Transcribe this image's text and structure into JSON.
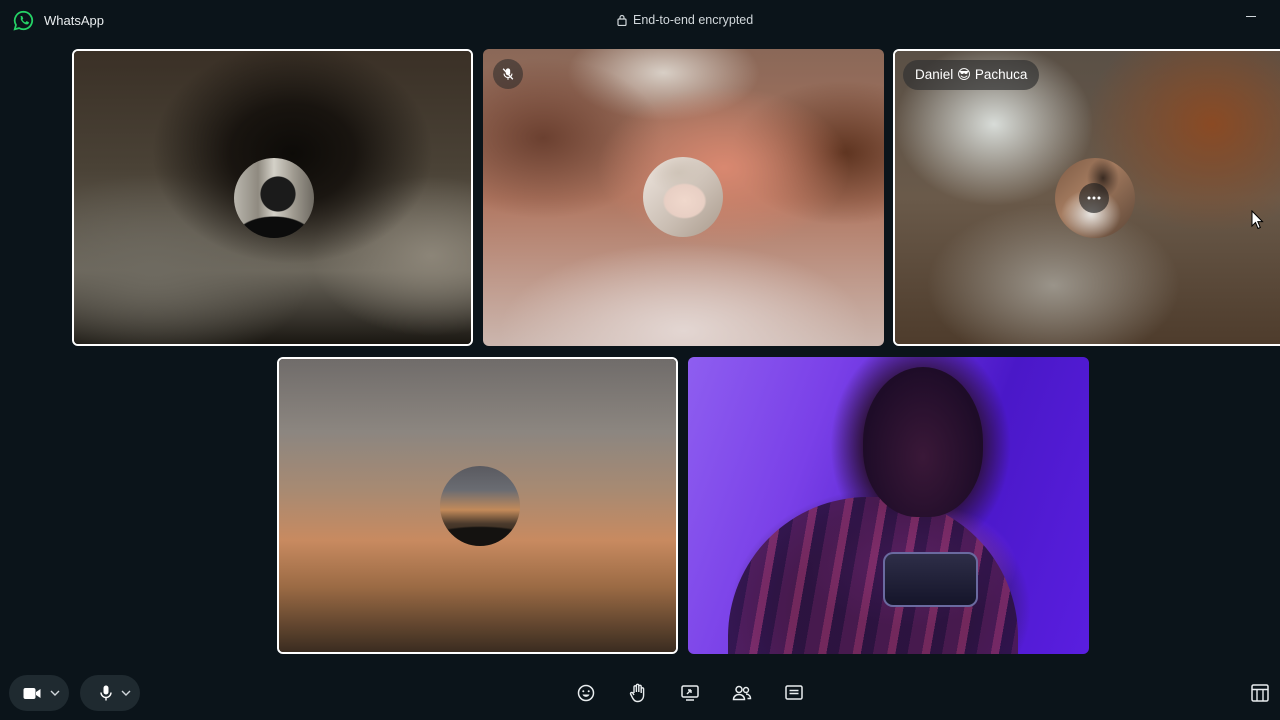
{
  "titlebar": {
    "app_name": "WhatsApp",
    "encryption_text": "End-to-end encrypted"
  },
  "tiles": [
    {
      "id": "tile-1",
      "selected": true,
      "muted": false,
      "label": ""
    },
    {
      "id": "tile-2",
      "selected": false,
      "muted": true,
      "label": ""
    },
    {
      "id": "tile-3",
      "selected": true,
      "muted": false,
      "label": "Daniel 😎 Pachuca"
    },
    {
      "id": "tile-4",
      "selected": true,
      "muted": false,
      "label": ""
    },
    {
      "id": "tile-5",
      "selected": false,
      "muted": false,
      "label": ""
    }
  ],
  "controls": {
    "left": [
      {
        "icon": "video-camera-icon"
      },
      {
        "icon": "microphone-icon"
      }
    ],
    "center": [
      {
        "icon": "emoji-icon"
      },
      {
        "icon": "raise-hand-icon"
      },
      {
        "icon": "screen-share-icon"
      },
      {
        "icon": "participants-icon"
      },
      {
        "icon": "chat-icon"
      }
    ],
    "right": [
      {
        "icon": "layout-icon"
      }
    ]
  },
  "colors": {
    "background": "#0b141a",
    "control_bg": "#1f2a30",
    "brand": "#25d366"
  }
}
